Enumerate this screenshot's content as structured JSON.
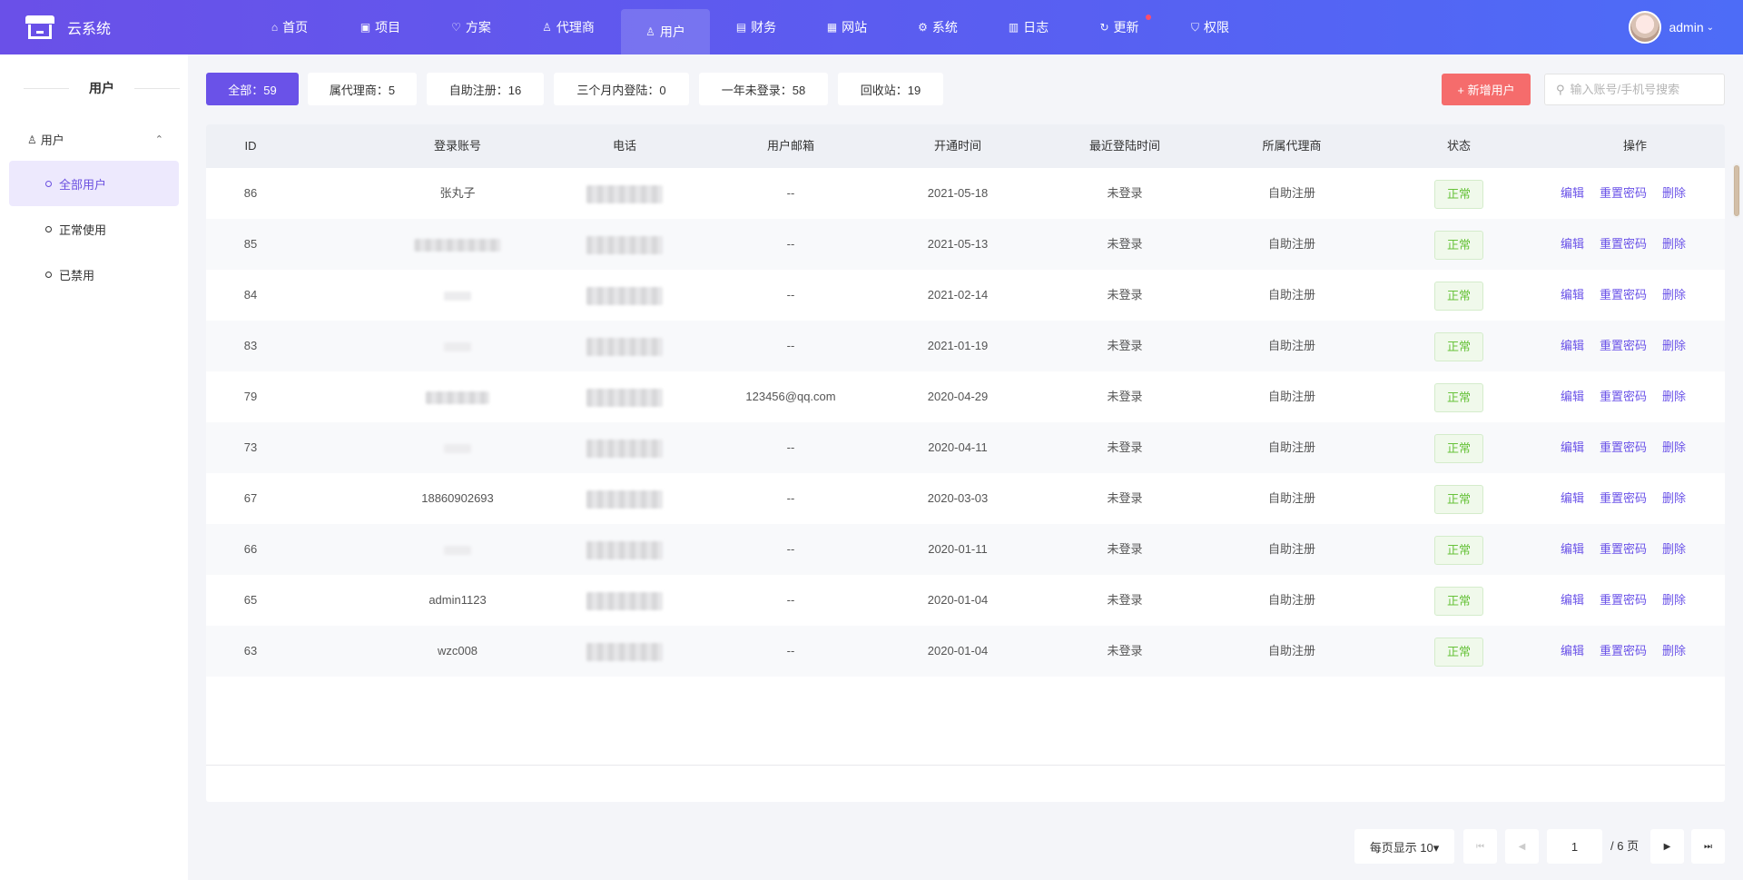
{
  "brand": {
    "name": "云系统"
  },
  "nav": [
    {
      "icon": "⌂",
      "label": "首页",
      "active": false,
      "dot": false
    },
    {
      "icon": "▣",
      "label": "项目",
      "active": false,
      "dot": false
    },
    {
      "icon": "♡",
      "label": "方案",
      "active": false,
      "dot": false
    },
    {
      "icon": "♙",
      "label": "代理商",
      "active": false,
      "dot": false
    },
    {
      "icon": "♙",
      "label": "用户",
      "active": true,
      "dot": false
    },
    {
      "icon": "▤",
      "label": "财务",
      "active": false,
      "dot": false
    },
    {
      "icon": "▦",
      "label": "网站",
      "active": false,
      "dot": false
    },
    {
      "icon": "⚙",
      "label": "系统",
      "active": false,
      "dot": false
    },
    {
      "icon": "▥",
      "label": "日志",
      "active": false,
      "dot": false
    },
    {
      "icon": "↻",
      "label": "更新",
      "active": false,
      "dot": true
    },
    {
      "icon": "⛉",
      "label": "权限",
      "active": false,
      "dot": false
    }
  ],
  "user": {
    "name": "admin",
    "caret": "⌄"
  },
  "sidebar": {
    "title": "用户",
    "group": {
      "icon": "♙",
      "label": "用户",
      "caret": "⌃"
    },
    "items": [
      {
        "label": "全部用户",
        "active": true
      },
      {
        "label": "正常使用",
        "active": false
      },
      {
        "label": "已禁用",
        "active": false
      }
    ]
  },
  "filters": [
    {
      "label": "全部：59",
      "active": true
    },
    {
      "label": "属代理商：5",
      "active": false
    },
    {
      "label": "自助注册：16",
      "active": false
    },
    {
      "label": "三个月内登陆：0",
      "active": false
    },
    {
      "label": "一年未登录：58",
      "active": false
    },
    {
      "label": "回收站：19",
      "active": false
    }
  ],
  "add_button": "+ 新增用户",
  "search": {
    "icon": "⚲",
    "placeholder": "输入账号/手机号搜索"
  },
  "table": {
    "columns": [
      "ID",
      "登录账号",
      "电话",
      "用户邮箱",
      "开通时间",
      "最近登陆时间",
      "所属代理商",
      "状态",
      "操作"
    ],
    "actions": {
      "edit": "编辑",
      "reset": "重置密码",
      "delete": "删除"
    },
    "rows": [
      {
        "id": "86",
        "account": "张丸子",
        "account_blur": "",
        "email": "--",
        "opened": "2021-05-18",
        "last_login": "未登录",
        "agent": "自助注册",
        "status": "正常"
      },
      {
        "id": "85",
        "account": "",
        "account_blur": "acct",
        "email": "--",
        "opened": "2021-05-13",
        "last_login": "未登录",
        "agent": "自助注册",
        "status": "正常"
      },
      {
        "id": "84",
        "account": "",
        "account_blur": "acct-xs",
        "email": "--",
        "opened": "2021-02-14",
        "last_login": "未登录",
        "agent": "自助注册",
        "status": "正常"
      },
      {
        "id": "83",
        "account": "",
        "account_blur": "acct-xs",
        "email": "--",
        "opened": "2021-01-19",
        "last_login": "未登录",
        "agent": "自助注册",
        "status": "正常"
      },
      {
        "id": "79",
        "account": "",
        "account_blur": "acct-s",
        "email": "123456@qq.com",
        "opened": "2020-04-29",
        "last_login": "未登录",
        "agent": "自助注册",
        "status": "正常"
      },
      {
        "id": "73",
        "account": "",
        "account_blur": "acct-xs",
        "email": "--",
        "opened": "2020-04-11",
        "last_login": "未登录",
        "agent": "自助注册",
        "status": "正常"
      },
      {
        "id": "67",
        "account": "18860902693",
        "account_blur": "",
        "email": "--",
        "opened": "2020-03-03",
        "last_login": "未登录",
        "agent": "自助注册",
        "status": "正常"
      },
      {
        "id": "66",
        "account": "",
        "account_blur": "acct-xs",
        "email": "--",
        "opened": "2020-01-11",
        "last_login": "未登录",
        "agent": "自助注册",
        "status": "正常"
      },
      {
        "id": "65",
        "account": "admin1123",
        "account_blur": "",
        "email": "--",
        "opened": "2020-01-04",
        "last_login": "未登录",
        "agent": "自助注册",
        "status": "正常"
      },
      {
        "id": "63",
        "account": "wzc008",
        "account_blur": "",
        "email": "--",
        "opened": "2020-01-04",
        "last_login": "未登录",
        "agent": "自助注册",
        "status": "正常"
      }
    ]
  },
  "pagination": {
    "page_size_label": "每页显示 10▾",
    "first": "⏮",
    "prev": "◀",
    "current_page": "1",
    "total": "/ 6 页",
    "next": "▶",
    "last": "⏭"
  },
  "colors": {
    "accent": "#6a52e8",
    "danger": "#f56c6c",
    "success": "#67c23a"
  }
}
